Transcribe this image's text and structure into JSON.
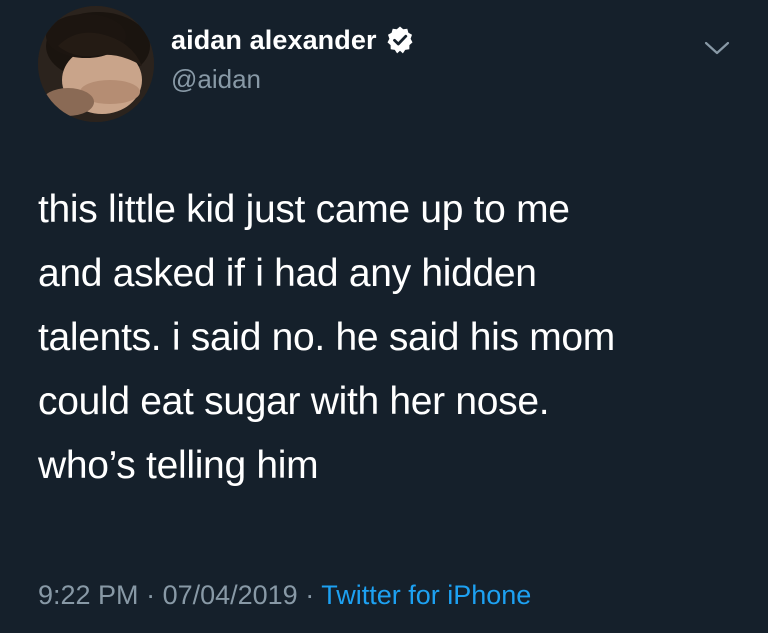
{
  "user": {
    "display_name": "aidan alexander",
    "handle": "@aidan",
    "verified": true
  },
  "tweet": {
    "text": "this little kid just came up to me\nand asked if i had any hidden\ntalents. i said no. he said his mom\ncould eat sugar with her nose.\nwho’s telling him"
  },
  "meta": {
    "time": "9:22 PM",
    "separator": " · ",
    "date": "07/04/2019",
    "separator2": " · ",
    "source": "Twitter for iPhone"
  },
  "colors": {
    "background": "#15202b",
    "text": "#ffffff",
    "secondary": "#8899a6",
    "accent": "#1da1f2"
  },
  "icons": {
    "verified": "verified-badge-icon",
    "menu": "chevron-down-icon"
  }
}
